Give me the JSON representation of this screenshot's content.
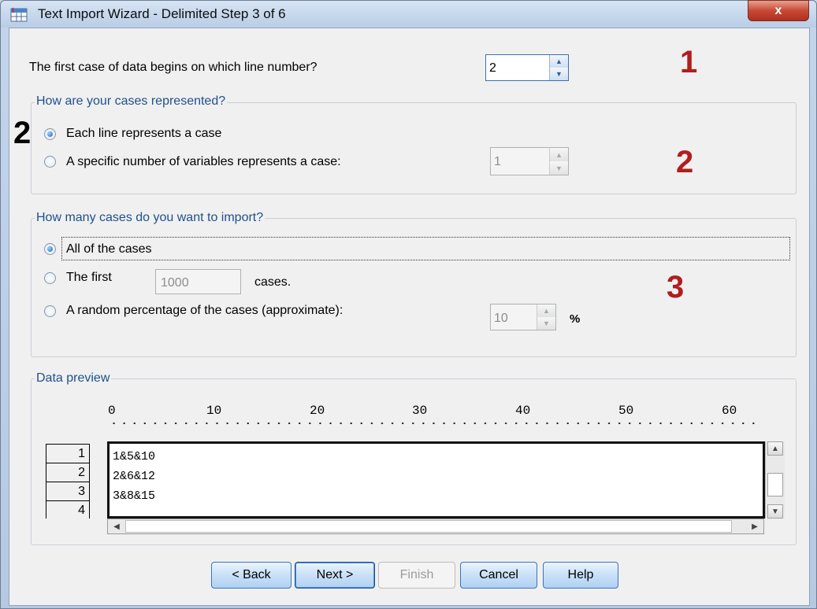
{
  "window": {
    "title": "Text Import Wizard - Delimited Step 3 of 6",
    "close_label": "x"
  },
  "first_case": {
    "label": "The first case of data begins on which line number?",
    "value": "2"
  },
  "cases_group": {
    "title": "How are your cases represented?",
    "option_each_line": "Each line represents a case",
    "option_specific": "A specific number of variables represents a case:",
    "specific_value": "1",
    "selected": "each_line"
  },
  "import_group": {
    "title": "How many cases do you want to import?",
    "option_all": "All of the cases",
    "option_first": "The first",
    "first_value": "1000",
    "first_suffix": "cases.",
    "option_random": "A random percentage of the cases (approximate):",
    "random_value": "10",
    "random_suffix": "%",
    "selected": "all"
  },
  "preview_group": {
    "title": "Data preview",
    "ruler_labels": [
      "0",
      "10",
      "20",
      "30",
      "40",
      "50",
      "60"
    ],
    "row_numbers": [
      "1",
      "2",
      "3",
      "4"
    ],
    "lines": [
      "1&5&10",
      "2&6&12",
      "3&8&15"
    ]
  },
  "buttons": {
    "back": "< Back",
    "next": "Next >",
    "finish": "Finish",
    "cancel": "Cancel",
    "help": "Help"
  },
  "annotations": {
    "a1": "1",
    "a2_left": "2",
    "a2_right": "2",
    "a3": "3"
  },
  "colors": {
    "annotation_red": "#b11d1d",
    "group_title_blue": "#1f4f8f",
    "close_red": "#c74a36"
  }
}
